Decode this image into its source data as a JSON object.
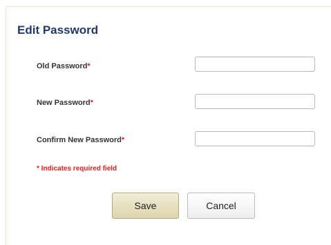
{
  "form": {
    "title": "Edit Password",
    "old_password": {
      "label": "Old Password",
      "required_mark": "*",
      "value": "",
      "placeholder": ""
    },
    "new_password": {
      "label": "New Password",
      "required_mark": "*",
      "value": "",
      "placeholder": ""
    },
    "confirm_password": {
      "label": "Confirm New Password",
      "required_mark": "*",
      "value": "",
      "placeholder": ""
    },
    "required_note": "* Indicates required field",
    "save_label": "Save",
    "cancel_label": "Cancel"
  },
  "colors": {
    "title": "#1f3a68",
    "required": "#e0201b",
    "save_button": "#dcd5ad",
    "panel_border": "#e8e5c8"
  }
}
